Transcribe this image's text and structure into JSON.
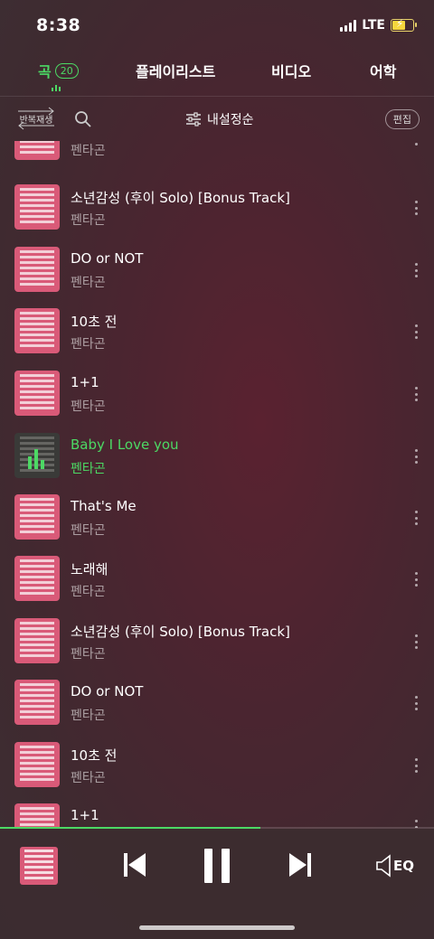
{
  "status": {
    "time": "8:38",
    "network": "LTE",
    "battery_level": 0.6
  },
  "tabs": [
    {
      "label": "곡",
      "count": "20",
      "active": true
    },
    {
      "label": "플레이리스트"
    },
    {
      "label": "비디오"
    },
    {
      "label": "어학"
    }
  ],
  "toolbar": {
    "repeat_label": "반복재생",
    "sort_label": "내설정순",
    "edit_label": "편집"
  },
  "songs": [
    {
      "title": "",
      "artist": "펜타곤"
    },
    {
      "title": "소년감성 (후이 Solo) [Bonus Track]",
      "artist": "펜타곤"
    },
    {
      "title": "DO or NOT",
      "artist": "펜타곤"
    },
    {
      "title": "10초 전",
      "artist": "펜타곤"
    },
    {
      "title": "1+1",
      "artist": "펜타곤"
    },
    {
      "title": "Baby I Love you",
      "artist": "펜타곤",
      "playing": true
    },
    {
      "title": "That's Me",
      "artist": "펜타곤"
    },
    {
      "title": "노래해",
      "artist": "펜타곤"
    },
    {
      "title": "소년감성 (후이 Solo) [Bonus Track]",
      "artist": "펜타곤"
    },
    {
      "title": "DO or NOT",
      "artist": "펜타곤"
    },
    {
      "title": "10초 전",
      "artist": "펜타곤"
    },
    {
      "title": "1+1",
      "artist": ""
    }
  ],
  "player": {
    "progress": 0.6,
    "eq_label": "EQ"
  },
  "colors": {
    "accent": "#4cd964",
    "album": "#d95a78"
  }
}
